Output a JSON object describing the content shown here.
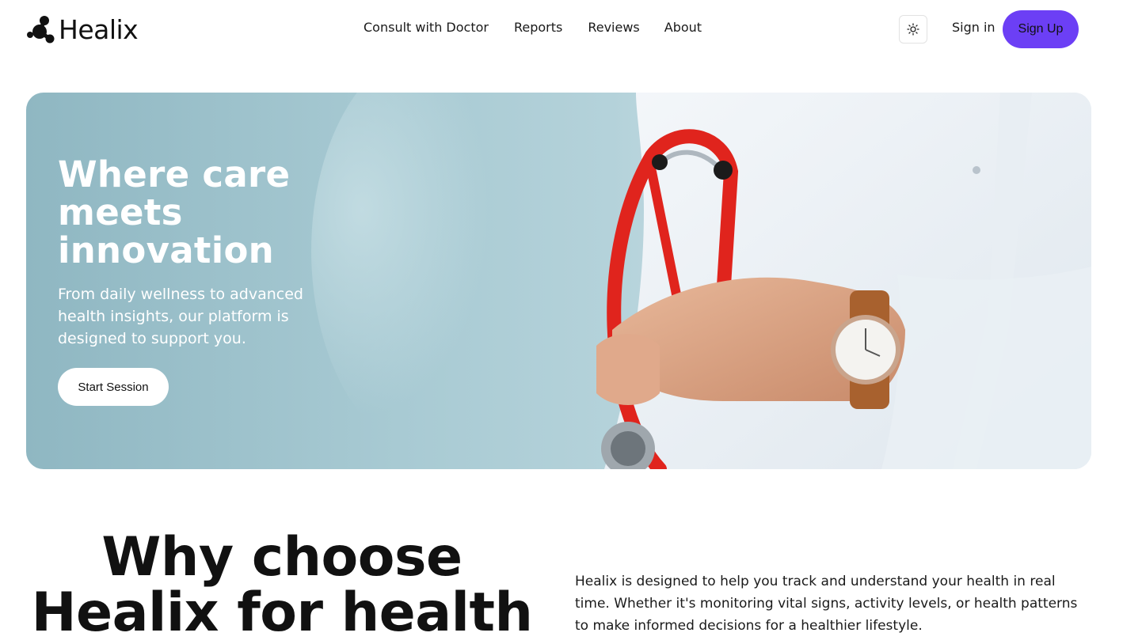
{
  "brand": {
    "name": "Healix",
    "logo_icon": "molecule-logo-icon"
  },
  "nav": {
    "links": [
      "Consult with Doctor",
      "Reports",
      "Reviews",
      "About"
    ],
    "theme_icon": "sun-icon",
    "signin_label": "Sign in",
    "signup_label": "Sign Up"
  },
  "hero": {
    "title": "Where care meets innovation",
    "subtitle": "From daily wellness to advanced health insights, our platform is designed to support you.",
    "cta_label": "Start Session",
    "image": "doctor-with-stethoscope-photo"
  },
  "why": {
    "title": "Why choose Healix for health",
    "text": "Healix is designed to help you track and understand your health in real time. Whether it's monitoring vital signs, activity levels, or health patterns to make informed decisions for a healthier lifestyle."
  },
  "colors": {
    "accent": "#6c3ff5",
    "hero_bg": "#a8cad3",
    "text": "#111111"
  }
}
